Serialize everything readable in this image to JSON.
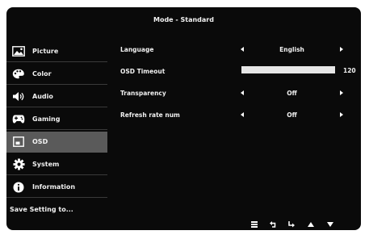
{
  "header": {
    "title": "Mode - Standard"
  },
  "sidebar": {
    "items": [
      {
        "label": "Picture",
        "icon": "picture-icon",
        "active": false
      },
      {
        "label": "Color",
        "icon": "palette-icon",
        "active": false
      },
      {
        "label": "Audio",
        "icon": "speaker-icon",
        "active": false
      },
      {
        "label": "Gaming",
        "icon": "gamepad-icon",
        "active": false
      },
      {
        "label": "OSD",
        "icon": "osd-window-icon",
        "active": true
      },
      {
        "label": "System",
        "icon": "gear-icon",
        "active": false
      },
      {
        "label": "Information",
        "icon": "info-icon",
        "active": false
      },
      {
        "label": "Save Setting to...",
        "icon": "",
        "active": false
      }
    ]
  },
  "settings": {
    "language": {
      "label": "Language",
      "value": "English"
    },
    "osd_timeout": {
      "label": "OSD Timeout",
      "value": "120",
      "level": 1.0
    },
    "transparency": {
      "label": "Transparency",
      "value": "Off"
    },
    "refresh_rate_num": {
      "label": "Refresh rate num",
      "value": "Off"
    }
  },
  "footer": {
    "buttons": [
      "menu-icon",
      "back-icon",
      "enter-icon",
      "up-icon",
      "down-icon"
    ]
  },
  "colors": {
    "background": "#0a0a0a",
    "active_item": "#5a5a5a",
    "text": "#f0f0f0"
  }
}
